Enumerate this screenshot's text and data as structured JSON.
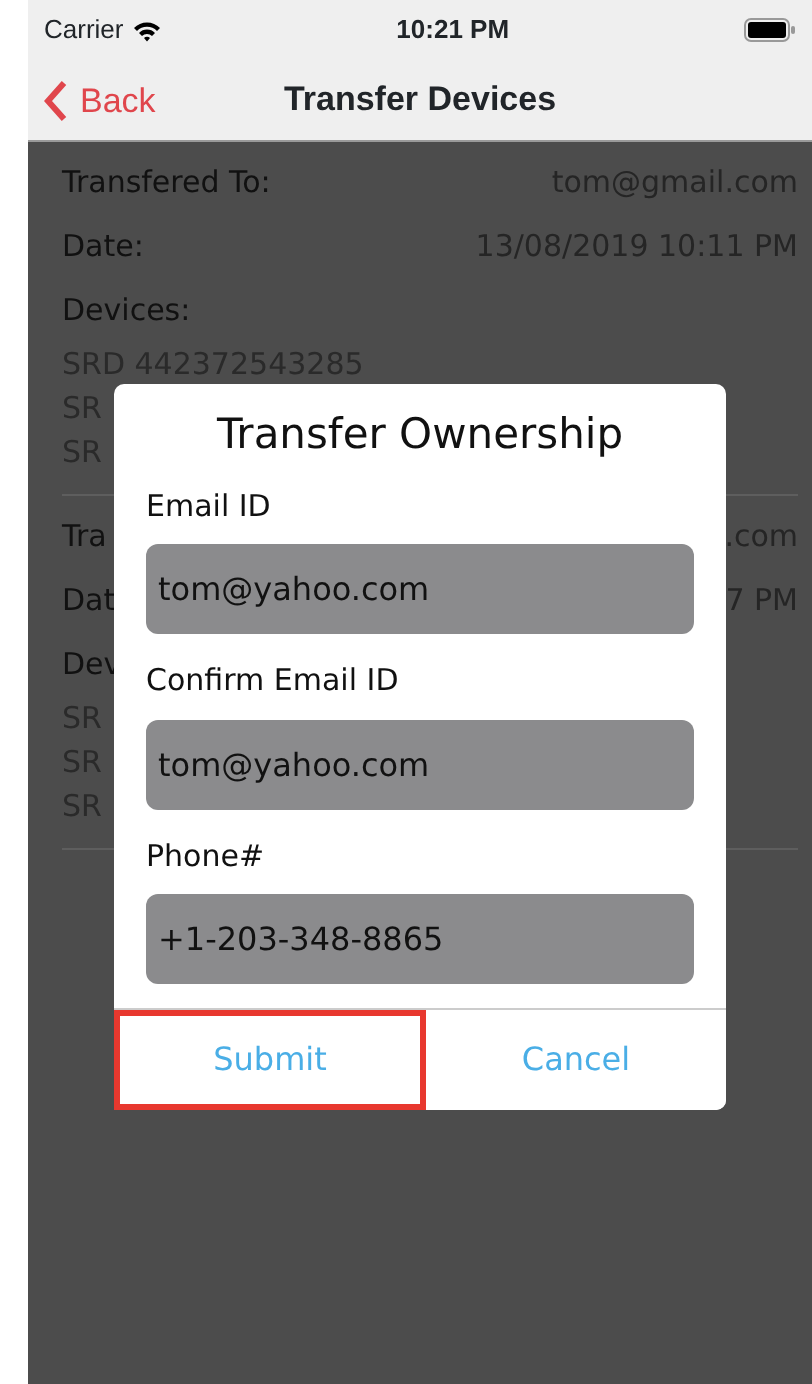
{
  "status_bar": {
    "carrier": "Carrier",
    "time": "10:21 PM"
  },
  "nav_bar": {
    "back": "Back",
    "title": "Transfer Devices"
  },
  "transfers": [
    {
      "rows": [
        {
          "label": "Transfered To:",
          "value": "tom@gmail.com"
        },
        {
          "label": "Date:",
          "value": "13/08/2019 10:11 PM"
        }
      ],
      "devices_label": "Devices:",
      "devices": [
        "SRD 442372543285",
        "SR",
        "SR"
      ]
    },
    {
      "rows": [
        {
          "label": "Tra",
          "value": ".com"
        },
        {
          "label": "Dat",
          "value": "7 PM"
        }
      ],
      "devices_label": "Dev",
      "devices": [
        "SR",
        "SR",
        "SR"
      ]
    }
  ],
  "dialog": {
    "title": "Transfer Ownership",
    "fields": [
      {
        "label": "Email ID",
        "value": "tom@yahoo.com"
      },
      {
        "label": "Confirm Email ID",
        "value": "tom@yahoo.com"
      },
      {
        "label": "Phone#",
        "value": "+1-203-348-8865"
      }
    ],
    "buttons": [
      {
        "label": "Submit",
        "highlighted": true
      },
      {
        "label": "Cancel",
        "highlighted": false
      }
    ]
  }
}
